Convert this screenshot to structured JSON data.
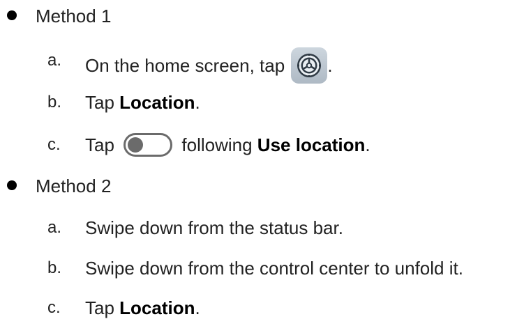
{
  "methods": [
    {
      "title": "Method 1",
      "steps": [
        {
          "marker": "a.",
          "text_before": "On the home screen, tap",
          "icon": "settings-gear-icon",
          "text_after": "."
        },
        {
          "marker": "b.",
          "text_before": "Tap ",
          "bold": "Location",
          "text_after": "."
        },
        {
          "marker": "c.",
          "text_before": "Tap",
          "icon": "toggle-switch-icon",
          "text_middle": "following ",
          "bold": "Use location",
          "text_after": "."
        }
      ]
    },
    {
      "title": "Method 2",
      "steps": [
        {
          "marker": "a.",
          "text": "Swipe down from the status bar."
        },
        {
          "marker": "b.",
          "text": "Swipe down from the control center to unfold it."
        },
        {
          "marker": "c.",
          "text_before": "Tap ",
          "bold": "Location",
          "text_after": "."
        }
      ]
    }
  ]
}
